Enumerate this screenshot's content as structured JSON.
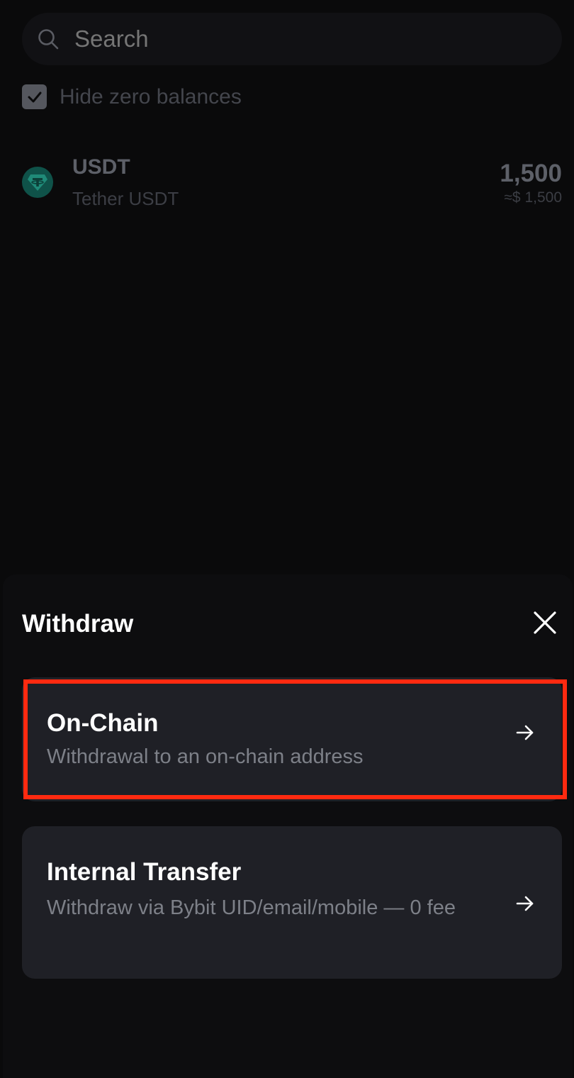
{
  "search": {
    "placeholder": "Search",
    "icon": "search-icon"
  },
  "filters": {
    "hide_zero_label": "Hide zero balances",
    "hide_zero_checked": true
  },
  "assets": [
    {
      "symbol": "USDT",
      "name": "Tether USDT",
      "amount": "1,500",
      "fiat": "≈$ 1,500",
      "icon": "tether-icon",
      "icon_color": "#26a17b"
    }
  ],
  "sheet": {
    "title": "Withdraw",
    "close_icon": "close-icon",
    "options": [
      {
        "title": "On-Chain",
        "description": "Withdrawal to an on-chain address",
        "icon": "arrow-right-icon",
        "highlighted": true
      },
      {
        "title": "Internal Transfer",
        "description": "Withdraw via Bybit UID/email/mobile  — 0 fee",
        "icon": "arrow-right-icon",
        "highlighted": false
      }
    ]
  },
  "colors": {
    "highlight": "#ff2a10",
    "card_bg": "#1f2026",
    "sheet_bg": "#0d0d0f"
  }
}
